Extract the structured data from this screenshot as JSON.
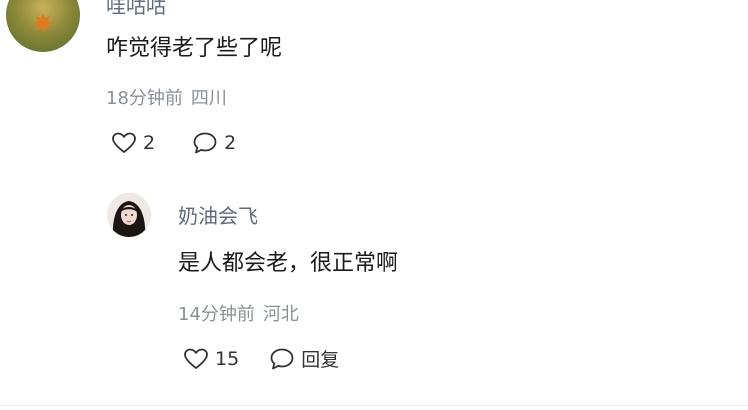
{
  "comment": {
    "username": "哇咕咕",
    "content": "咋觉得老了些了呢",
    "time": "18分钟前",
    "location": "四川",
    "likes": "2",
    "replies": "2",
    "avatar_icon": "maple-leaf-avatar"
  },
  "reply": {
    "username": "奶油会飞",
    "content": "是人都会老，很正常啊",
    "time": "14分钟前",
    "location": "河北",
    "likes": "15",
    "reply_label": "回复",
    "avatar_icon": "woman-portrait-avatar"
  },
  "colors": {
    "username": "#5e6a7c",
    "meta": "#8a8f99",
    "text": "#1a1a1a"
  }
}
